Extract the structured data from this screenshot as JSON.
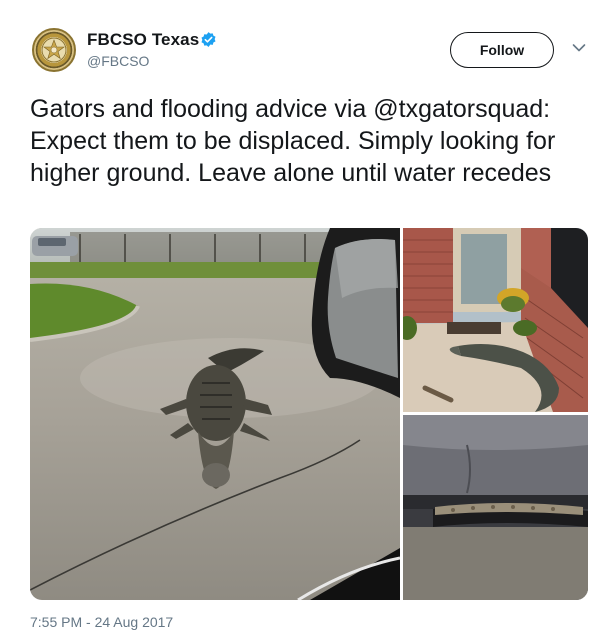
{
  "account": {
    "display_name": "FBCSO Texas",
    "handle": "@FBCSO",
    "verified": true,
    "avatar_icon": "sheriff-badge-icon"
  },
  "actions": {
    "follow_label": "Follow",
    "more_icon": "chevron-down-icon"
  },
  "tweet": {
    "text": "Gators and flooding advice via @txgatorsquad: Expect them to be displaced. Simply looking for higher ground. Leave alone until water recedes",
    "timestamp": "7:55 PM - 24 Aug 2017"
  },
  "media": {
    "count": 3
  },
  "colors": {
    "text": "#14171a",
    "secondary": "#657786",
    "verified_blue": "#1da1f2"
  }
}
